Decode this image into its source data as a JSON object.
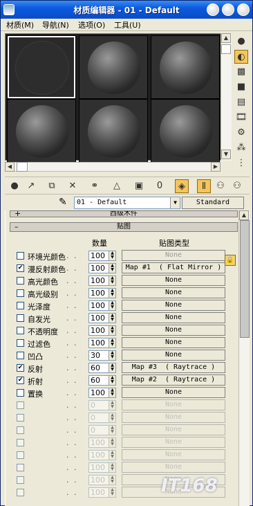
{
  "window": {
    "title": "材质编辑器 - 01 - Default"
  },
  "menu": [
    {
      "label": "材质(M)"
    },
    {
      "label": "导航(N)"
    },
    {
      "label": "选项(O)"
    },
    {
      "label": "工具(U)"
    }
  ],
  "slots": [
    {
      "name": "slot-1",
      "active": true
    },
    {
      "name": "slot-2"
    },
    {
      "name": "slot-3"
    },
    {
      "name": "slot-4"
    },
    {
      "name": "slot-5"
    },
    {
      "name": "slot-6"
    }
  ],
  "material": {
    "name": "01 - Default",
    "type_button": "Standard"
  },
  "rollouts": {
    "upper_label": "西级木件",
    "maps_label": "贴图",
    "upper_sign": "+",
    "maps_sign": "–"
  },
  "map_table": {
    "col_amount": "数量",
    "col_maptype": "贴图类型",
    "rows": [
      {
        "label": "环境光颜色",
        "checked": false,
        "amount": "100",
        "map": "None",
        "disabled_map": true
      },
      {
        "label": "漫反射颜色",
        "checked": true,
        "amount": "100",
        "map": "Map #1  ( Flat Mirror )"
      },
      {
        "label": "高光颜色",
        "checked": false,
        "amount": "100",
        "map": "None"
      },
      {
        "label": "高光级别",
        "checked": false,
        "amount": "100",
        "map": "None"
      },
      {
        "label": "光泽度",
        "checked": false,
        "amount": "100",
        "map": "None"
      },
      {
        "label": "自发光",
        "checked": false,
        "amount": "100",
        "map": "None"
      },
      {
        "label": "不透明度",
        "checked": false,
        "amount": "100",
        "map": "None"
      },
      {
        "label": "过滤色",
        "checked": false,
        "amount": "100",
        "map": "None"
      },
      {
        "label": "凹凸",
        "checked": false,
        "amount": "30",
        "map": "None"
      },
      {
        "label": "反射",
        "checked": true,
        "amount": "60",
        "map": "Map #3  ( Raytrace )"
      },
      {
        "label": "折射",
        "checked": true,
        "amount": "60",
        "map": "Map #2  ( Raytrace )"
      },
      {
        "label": "置换",
        "checked": false,
        "amount": "100",
        "map": "None"
      },
      {
        "label": "",
        "checked": false,
        "amount": "0",
        "map": "None",
        "disabled": true
      },
      {
        "label": "",
        "checked": false,
        "amount": "0",
        "map": "None",
        "disabled": true
      },
      {
        "label": "",
        "checked": false,
        "amount": "0",
        "map": "None",
        "disabled": true
      },
      {
        "label": "",
        "checked": false,
        "amount": "100",
        "map": "None",
        "disabled": true
      },
      {
        "label": "",
        "checked": false,
        "amount": "100",
        "map": "None",
        "disabled": true
      },
      {
        "label": "",
        "checked": false,
        "amount": "100",
        "map": "None",
        "disabled": true
      },
      {
        "label": "",
        "checked": false,
        "amount": "100",
        "map": "None",
        "disabled": true
      },
      {
        "label": "",
        "checked": false,
        "amount": "100",
        "map": "None",
        "disabled": true
      }
    ]
  },
  "watermark": "IT168",
  "colors": {
    "title_bar": "#0b5ae0",
    "window_bg": "#ece9d8",
    "active_tool": "#f5c55a"
  },
  "icons": {
    "side_tools": [
      "sample-type-sphere-icon",
      "backlight-icon",
      "background-checker-icon",
      "sample-uv-tiling-icon",
      "video-color-check-icon",
      "make-preview-icon",
      "options-icon",
      "select-by-material-icon",
      "material-map-navigator-icon"
    ],
    "bottom_tools": [
      "get-material-icon",
      "put-to-scene-icon",
      "assign-to-selection-icon",
      "reset-map-icon",
      "make-unique-icon",
      "put-to-library-icon",
      "material-effects-channel-icon",
      "show-map-in-viewport-icon",
      "show-end-result-icon",
      "go-to-parent-icon",
      "go-forward-to-sibling-icon"
    ]
  }
}
